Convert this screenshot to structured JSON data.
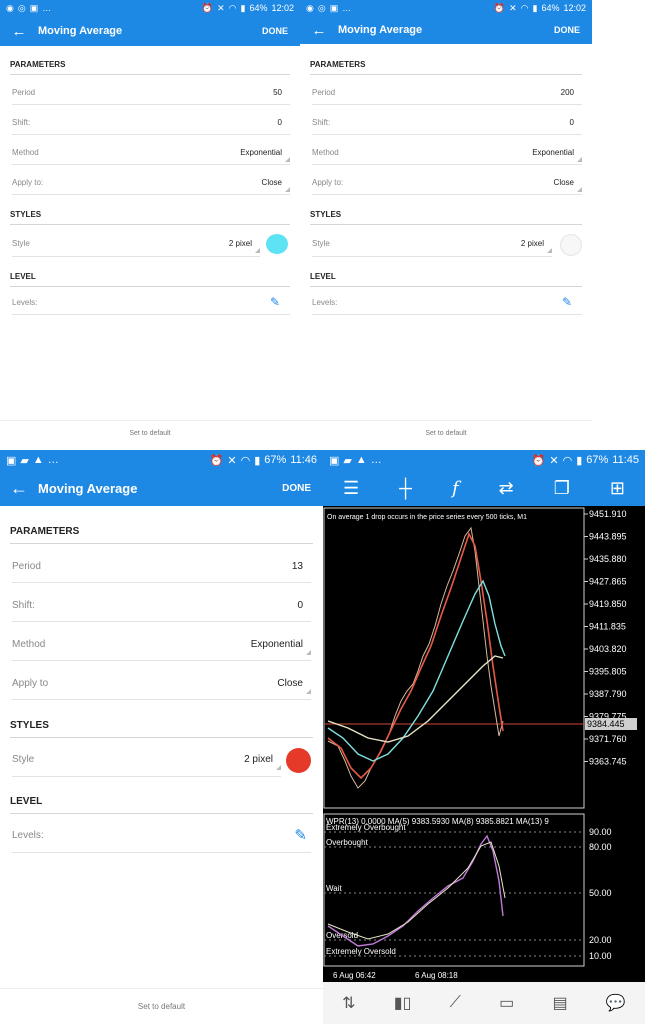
{
  "panels": [
    {
      "time": "12:02",
      "battery": "64%",
      "title": "Moving Average",
      "done": "DONE",
      "params_header": "PARAMETERS",
      "period_label": "Period",
      "period": "50",
      "shift_label": "Shift:",
      "shift": "0",
      "method_label": "Method",
      "method": "Exponential",
      "apply_label": "Apply to:",
      "apply": "Close",
      "styles_header": "STYLES",
      "style_label": "Style",
      "style": "2 pixel",
      "style_color": "#5ee3f5",
      "level_header": "LEVEL",
      "levels_label": "Levels:",
      "footer": "Set to default"
    },
    {
      "time": "12:02",
      "battery": "64%",
      "title": "Moving Average",
      "done": "DONE",
      "params_header": "PARAMETERS",
      "period_label": "Period",
      "period": "200",
      "shift_label": "Shift:",
      "shift": "0",
      "method_label": "Method",
      "method": "Exponential",
      "apply_label": "Apply to:",
      "apply": "Close",
      "styles_header": "STYLES",
      "style_label": "Style",
      "style": "2 pixel",
      "style_color": "#f7f7f7",
      "level_header": "LEVEL",
      "levels_label": "Levels:",
      "footer": "Set to default"
    },
    {
      "time": "11:46",
      "battery": "67%",
      "title": "Moving Average",
      "done": "DONE",
      "params_header": "PARAMETERS",
      "period_label": "Period",
      "period": "13",
      "shift_label": "Shift:",
      "shift": "0",
      "method_label": "Method",
      "method": "Exponential",
      "apply_label": "Apply to",
      "apply": "Close",
      "styles_header": "STYLES",
      "style_label": "Style",
      "style": "2 pixel",
      "style_color": "#e53a2a",
      "level_header": "LEVEL",
      "levels_label": "Levels:",
      "footer": "Set to default"
    }
  ],
  "chart": {
    "time": "11:45",
    "battery": "67%",
    "caption": "On average 1 drop occurs in the price series every 500 ticks, M1",
    "price_labels": [
      "9451.910",
      "9443.895",
      "9435.880",
      "9427.865",
      "9419.850",
      "9411.835",
      "9403.820",
      "9395.805",
      "9387.790",
      "9379.775",
      "9371.760",
      "9363.745"
    ],
    "current_price": "9384.445",
    "osc_header": "WPR(13) 0.0000 MA(5) 9383.5930 MA(8) 9385.8821 MA(13) 9",
    "osc_levels": [
      "Extremely Overbought",
      "Overbought",
      "Wait",
      "Oversold",
      "Extremely Oversold"
    ],
    "osc_scale": [
      "90.00",
      "80.00",
      "50.00",
      "20.00",
      "10.00"
    ],
    "time_labels": [
      "6 Aug 06:42",
      "6 Aug 08:18"
    ],
    "colors": {
      "ma_fast": "#e65a45",
      "ma_mid": "#7fe0e0",
      "ma_slow": "#e9e6c8",
      "price": "#d8b9a0",
      "level": "#d0493a",
      "osc": "#c07ad8"
    }
  }
}
